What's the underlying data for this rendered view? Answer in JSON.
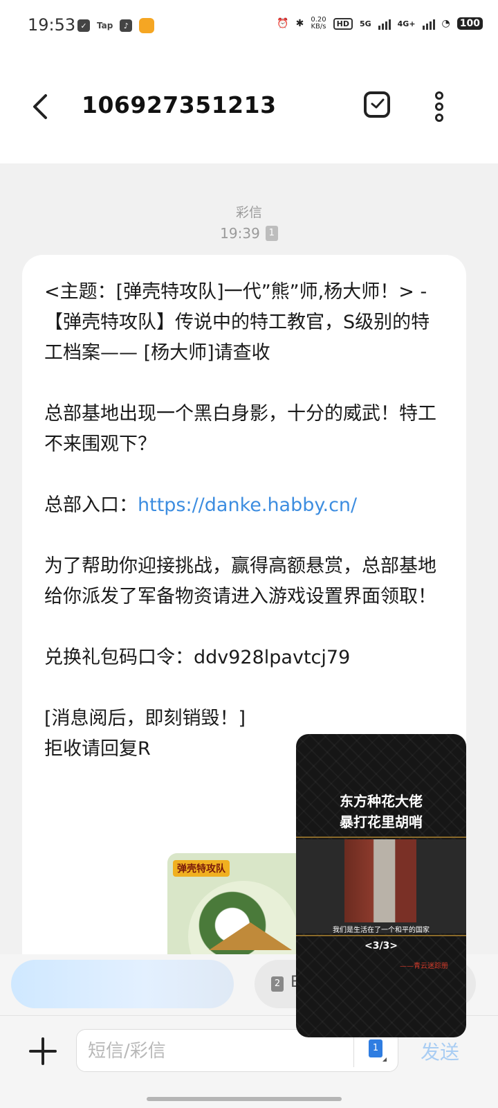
{
  "status_bar": {
    "time": "19:53",
    "left_icons": [
      "clipboard-icon",
      "tap-icon",
      "tiktok-icon",
      "game-icon"
    ],
    "tap_label": "Tap",
    "net_speed_value": "0.20",
    "net_speed_unit": "KB/s",
    "hd_label": "HD",
    "signal_5g": "5G",
    "signal_4g": "4G+",
    "battery": "100"
  },
  "header": {
    "title": "106927351213",
    "back_icon": "chevron-left-icon",
    "select_icon": "checkbox-icon",
    "more_icon": "more-vertical-icon"
  },
  "message": {
    "type": "彩信",
    "time": "19:39",
    "sim": "1",
    "lines": {
      "subject": "<主题：[弹壳特攻队]一代”熊”师,杨大师！> - 【弹壳特攻队】传说中的特工教官，S级别的特工档案—— [杨大师]请查收",
      "p2": "总部基地出现一个黑白身影，十分的威武！特工不来围观下？",
      "p3_prefix": "总部入口：",
      "p3_link": "https://danke.habby.cn/",
      "p4": "为了帮助你迎接挑战，赢得高额悬赏，总部基地给你派发了军备物资请进入游戏设置界面领取！",
      "p5": "兑换礼包码口令：ddv928lpavtcj79",
      "p6a": "[消息阅后，即刻销毁！]",
      "p6b": "拒收请回复R"
    },
    "image_tag": "弹壳特攻队"
  },
  "suggestion": {
    "sim": "2",
    "text": "E"
  },
  "composer": {
    "placeholder": "短信/彩信",
    "sim": "1",
    "send_label": "发送"
  },
  "pip": {
    "title_line1": "东方种花大佬",
    "title_line2": "暴打花里胡哨",
    "caption": "我们是生活在了一个和平的国家",
    "counter": "<3/3>",
    "subtitle": "——青云迷踪册"
  },
  "colors": {
    "link": "#3d8de0",
    "send_disabled": "#a9cdf3",
    "sim_blue": "#2f7de1"
  }
}
